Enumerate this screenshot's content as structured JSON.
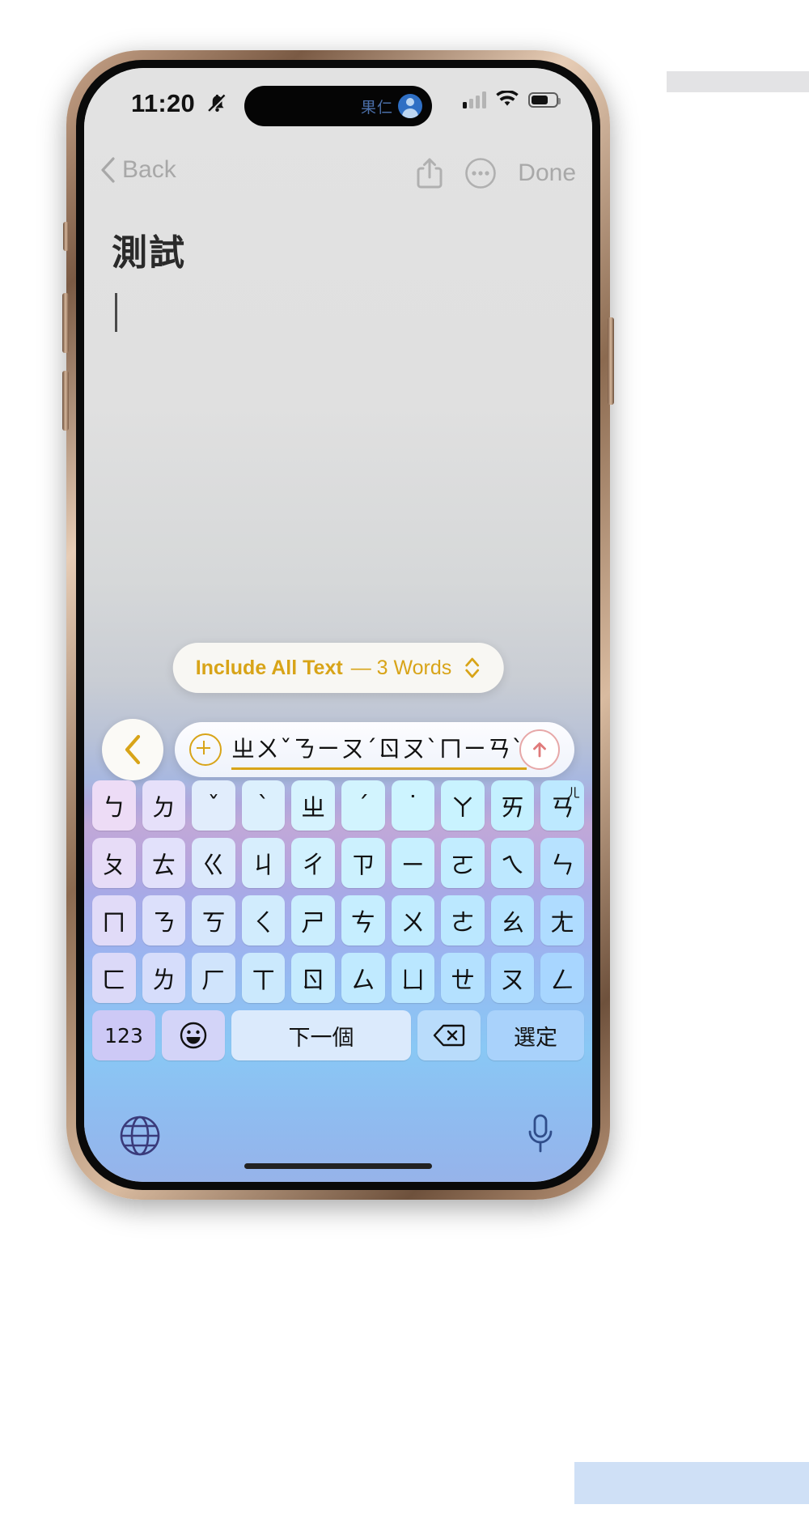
{
  "status_bar": {
    "time": "11:20",
    "silent_icon": "bell-slash-icon",
    "cellular_icon": "signal-bars-icon",
    "wifi_icon": "wifi-icon",
    "battery_icon": "battery-icon",
    "battery_fill_percent": 62
  },
  "dynamic_island": {
    "label": "果仁",
    "avatar_icon": "contact-avatar-icon"
  },
  "nav_bar": {
    "back_label": "Back",
    "back_icon": "chevron-left-icon",
    "share_icon": "share-icon",
    "more_icon": "ellipsis-circle-icon",
    "done_label": "Done"
  },
  "note": {
    "title": "測試",
    "body": ""
  },
  "pill": {
    "strong_label": "Include All Text",
    "normal_label": "— 3 Words",
    "stepper_icon": "chevron-up-down-icon",
    "accent_color": "#d8a418"
  },
  "input_row": {
    "prev_icon": "chevron-left-icon",
    "add_icon": "plus-circle-icon",
    "composing_text": "ㄓㄨˇㄋㄧㄡˊㄖㄡˋㄇㄧㄢˋ",
    "send_icon": "arrow-up-circle-icon"
  },
  "keyboard": {
    "rows": [
      [
        "ㄅ",
        "ㄉ",
        "ˇ",
        "ˋ",
        "ㄓ",
        "ˊ",
        "˙",
        "ㄚ",
        "ㄞ",
        "ㄢ"
      ],
      [
        "ㄆ",
        "ㄊ",
        "ㄍ",
        "ㄐ",
        "ㄔ",
        "ㄗ",
        "ㄧ",
        "ㄛ",
        "ㄟ",
        "ㄣ"
      ],
      [
        "ㄇ",
        "ㄋ",
        "ㄎ",
        "ㄑ",
        "ㄕ",
        "ㄘ",
        "ㄨ",
        "ㄜ",
        "ㄠ",
        "ㄤ"
      ],
      [
        "ㄈ",
        "ㄌ",
        "ㄏ",
        "ㄒ",
        "ㄖ",
        "ㄙ",
        "ㄩ",
        "ㄝ",
        "ㄡ",
        "ㄥ"
      ]
    ],
    "last_key_superscript": "ㄦ",
    "bottom_row": {
      "numbers_label": "123",
      "emoji_icon": "smiley-icon",
      "space_label": "下一個",
      "delete_icon": "backspace-icon",
      "select_label": "選定"
    },
    "globe_icon": "globe-icon",
    "mic_icon": "microphone-icon"
  }
}
